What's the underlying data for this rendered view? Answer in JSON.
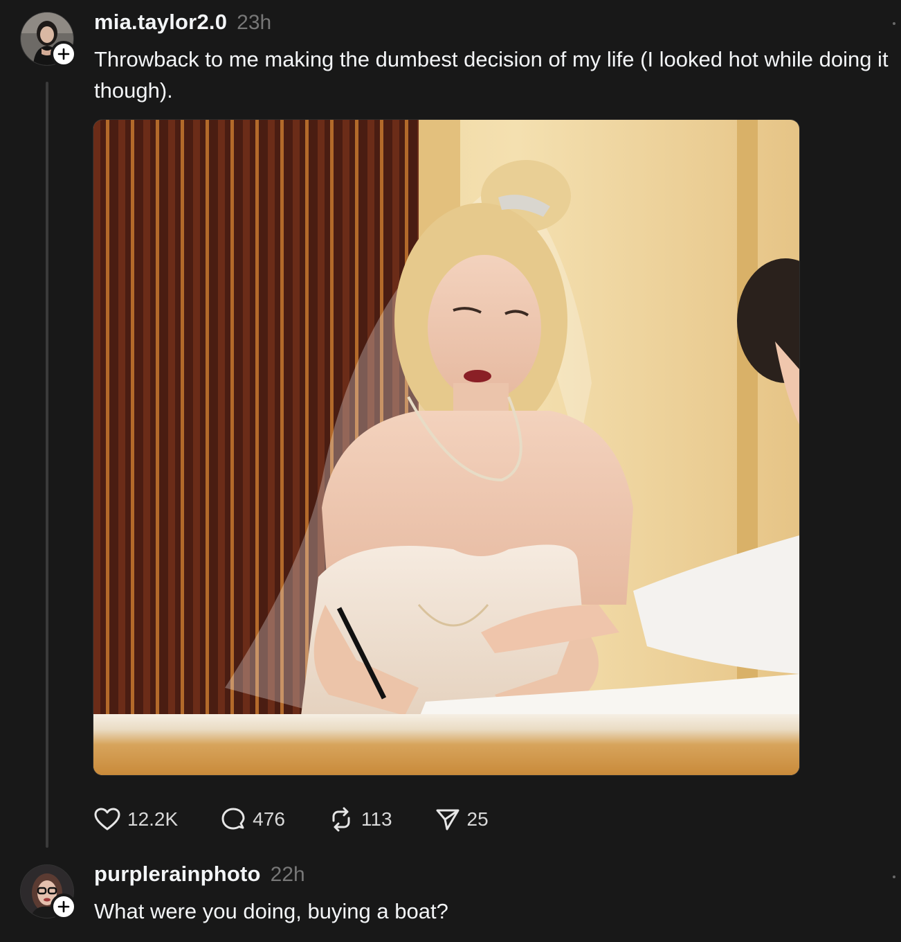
{
  "posts": [
    {
      "username": "mia.taylor2.0",
      "time": "23h",
      "text": "Throwback to me making the dumbest decision of my life (I looked hot while doing it though).",
      "has_image": true,
      "actions": {
        "likes": "12.2K",
        "replies": "476",
        "reposts": "113",
        "shares": "25"
      }
    },
    {
      "username": "purplerainphoto",
      "time": "22h",
      "text": "What were you doing, buying a boat?"
    }
  ],
  "icons": {
    "like": "heart-icon",
    "reply": "comment-bubble-icon",
    "repost": "repost-arrows-icon",
    "share": "send-paper-plane-icon",
    "follow": "plus-icon",
    "more": "more-dots-icon"
  },
  "colors": {
    "background": "#181818",
    "text_primary": "#f3f5f7",
    "text_secondary": "#777777",
    "thread_line": "#3a3a3a"
  }
}
